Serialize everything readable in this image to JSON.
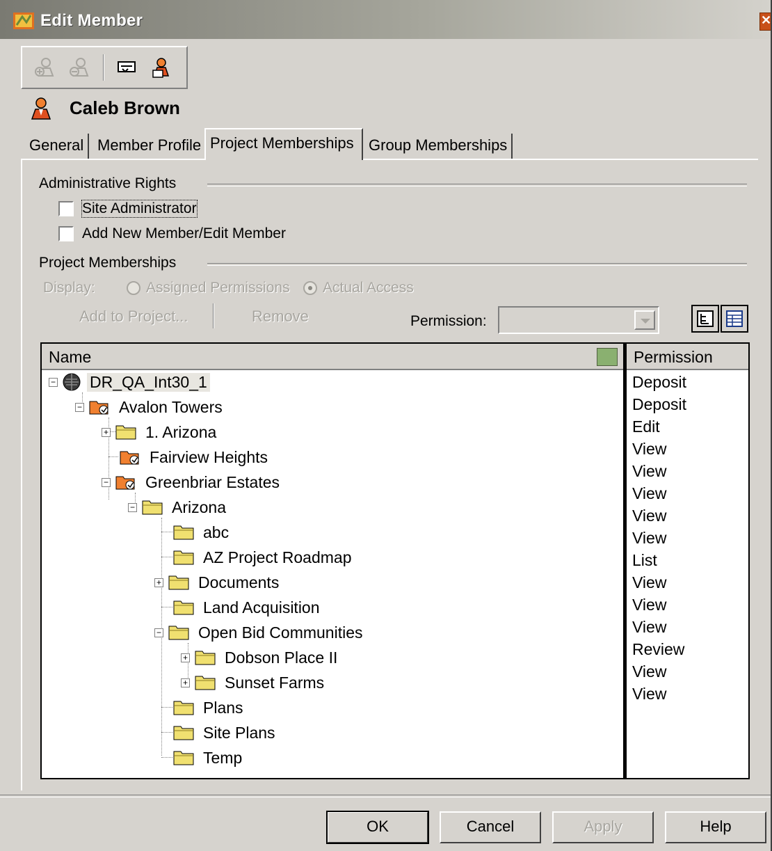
{
  "window": {
    "title": "Edit Member"
  },
  "member": {
    "name": "Caleb Brown"
  },
  "tabs": [
    {
      "label": "General"
    },
    {
      "label": "Member Profile"
    },
    {
      "label": "Project Memberships"
    },
    {
      "label": "Group Memberships"
    }
  ],
  "active_tab": "Project Memberships",
  "admin_rights": {
    "label": "Administrative Rights",
    "site_admin": {
      "label": "Site Administrator",
      "checked": false
    },
    "add_edit_member": {
      "label": "Add New Member/Edit Member",
      "checked": false
    }
  },
  "project_memberships": {
    "label": "Project Memberships",
    "display_label": "Display:",
    "radio_assigned": "Assigned Permissions",
    "radio_actual": "Actual Access",
    "add_to_project": "Add to Project...",
    "remove": "Remove",
    "permission_label": "Permission:",
    "permission_value": ""
  },
  "grid": {
    "name_header": "Name",
    "permission_header": "Permission",
    "rows": [
      {
        "name": "DR_QA_Int30_1",
        "permission": "Deposit"
      },
      {
        "name": "Avalon Towers",
        "permission": "Deposit"
      },
      {
        "name": "1. Arizona",
        "permission": "Edit"
      },
      {
        "name": "Fairview Heights",
        "permission": "View"
      },
      {
        "name": "Greenbriar Estates",
        "permission": "View"
      },
      {
        "name": "Arizona",
        "permission": "View"
      },
      {
        "name": "abc",
        "permission": "View"
      },
      {
        "name": "AZ Project Roadmap",
        "permission": "View"
      },
      {
        "name": "Documents",
        "permission": "List"
      },
      {
        "name": "Land Acquisition",
        "permission": "View"
      },
      {
        "name": "Open Bid Communities",
        "permission": "View"
      },
      {
        "name": "Dobson Place II",
        "permission": "View"
      },
      {
        "name": "Sunset Farms",
        "permission": "Review"
      },
      {
        "name": "Plans",
        "permission": "View"
      },
      {
        "name": "Site Plans",
        "permission": "View"
      },
      {
        "name": "Temp",
        "permission": ""
      }
    ]
  },
  "buttons": {
    "ok": "OK",
    "cancel": "Cancel",
    "apply": "Apply",
    "help": "Help"
  },
  "icons": {
    "app": "app-icon",
    "close": "close-icon",
    "add_member": "add-member-icon",
    "remove_member": "remove-member-icon",
    "message": "message-icon",
    "member_card": "member-card-icon",
    "member": "member-icon",
    "server": "server-icon",
    "project": "project-icon",
    "folder": "folder-icon"
  }
}
